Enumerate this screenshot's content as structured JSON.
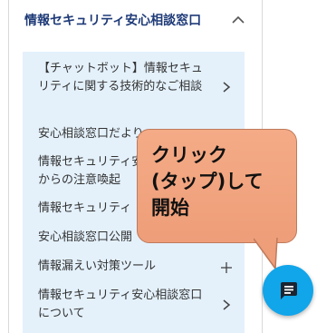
{
  "section": {
    "title": "情報セキュリティ安心相談窓口",
    "collapse_icon": "chevron-up-icon"
  },
  "items": [
    {
      "label": "【チャットボット】情報セキュリティに関する技術的なご相談",
      "icon": "chevron-right-icon"
    },
    {
      "label": "安心相談窓口だより",
      "icon": "chevron-right-icon"
    },
    {
      "label": "情報セキュリティ安心相談窓口からの注意喚起",
      "icon": "plus-icon"
    },
    {
      "label": "情報セキュリティ",
      "icon": "plus-icon"
    },
    {
      "label": "安心相談窓口公開",
      "icon": "plus-icon"
    },
    {
      "label": "情報漏えい対策ツール",
      "icon": "plus-icon"
    },
    {
      "label": "情報セキュリティ安心相談窓口について",
      "icon": "chevron-right-icon"
    }
  ],
  "callout": {
    "text": "クリック\n(タップ)して\n開始"
  },
  "chat_button": {
    "icon": "chat-bubble-icon"
  },
  "colors": {
    "title": "#1f3b78",
    "panel_background": "#e4f1fb",
    "callout": "#f2a47f",
    "chat_button": "#11a5ea"
  }
}
